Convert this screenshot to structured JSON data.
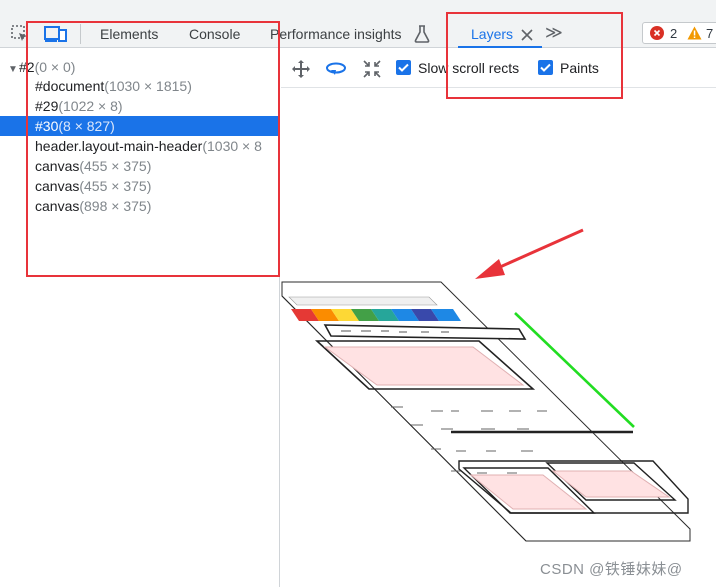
{
  "tabs": {
    "elements": "Elements",
    "console": "Console",
    "performance": "Performance insights",
    "layers": "Layers",
    "more": "≫"
  },
  "badges": {
    "errors": "2",
    "warnings": "7",
    "error_color": "#d93025",
    "warning_color": "#f29900"
  },
  "tree": {
    "root": {
      "name": "#2",
      "size": "(0 × 0)"
    },
    "items": [
      {
        "name": "#document",
        "size": "(1030 × 1815)"
      },
      {
        "name": "#29",
        "size": "(1022 × 8)"
      },
      {
        "name": "#30",
        "size": "(8 × 827)"
      },
      {
        "name": "header.layout-main-header",
        "size": "(1030 × 8"
      },
      {
        "name": "canvas",
        "size": "(455 × 375)"
      },
      {
        "name": "canvas",
        "size": "(455 × 375)"
      },
      {
        "name": "canvas",
        "size": "(898 × 375)"
      }
    ]
  },
  "toolbar": {
    "slow_scroll_label": "Slow scroll rects",
    "paints_label": "Paints",
    "slow_scroll_checked": true,
    "paints_checked": true
  },
  "colors": {
    "accent": "#1a73e8",
    "annotation": "#e8333a"
  },
  "watermark": "CSDN @铁锤妹妹@"
}
